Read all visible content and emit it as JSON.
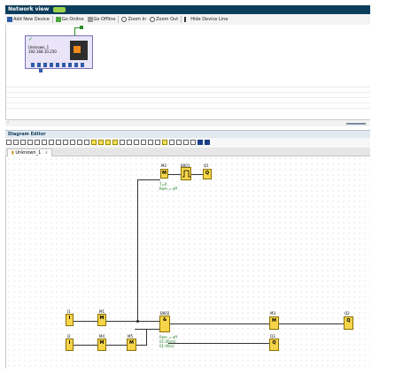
{
  "network_view": {
    "title": "Network view",
    "toolbar": [
      {
        "label": "Add New Device",
        "icon": "add-device-icon"
      },
      {
        "label": "Go Online",
        "icon": "go-online-icon"
      },
      {
        "label": "Go Offline",
        "icon": "go-offline-icon"
      },
      {
        "label": "Zoom In",
        "icon": "zoom-in-icon"
      },
      {
        "label": "Zoom Out",
        "icon": "zoom-out-icon"
      },
      {
        "label": "Hide Device Line",
        "icon": "device-line-icon"
      }
    ],
    "device": {
      "name": "Unknown_1",
      "ip": "192.168.10.250"
    }
  },
  "diagram_editor": {
    "title": "Diagram Editor",
    "tab_label": "Unknown_1",
    "tab_close": "x"
  },
  "blocks": {
    "m2": {
      "label": "M2",
      "text": "M"
    },
    "b001": {
      "label": "B001"
    },
    "q1": {
      "label": "Q1",
      "text": "Q"
    },
    "i1": {
      "label": "I1",
      "text": "I"
    },
    "m1": {
      "label": "M1",
      "text": "M"
    },
    "b002": {
      "label": "B002",
      "text": "&"
    },
    "m3": {
      "label": "M3",
      "text": "M"
    },
    "q2": {
      "label": "Q2",
      "text": "Q"
    },
    "i2": {
      "label": "I2",
      "text": "I"
    },
    "m4": {
      "label": "M4",
      "text": "M"
    },
    "m5": {
      "label": "M5",
      "text": "M"
    },
    "q3": {
      "label": "Q3",
      "text": "Q"
    }
  },
  "params": {
    "b001_line1": "T=0",
    "b001_line2": "Rem = off",
    "b002_line1": "Rem = off",
    "b002_line2": "01:00(m)",
    "b002_line3": "01:00(s)"
  }
}
